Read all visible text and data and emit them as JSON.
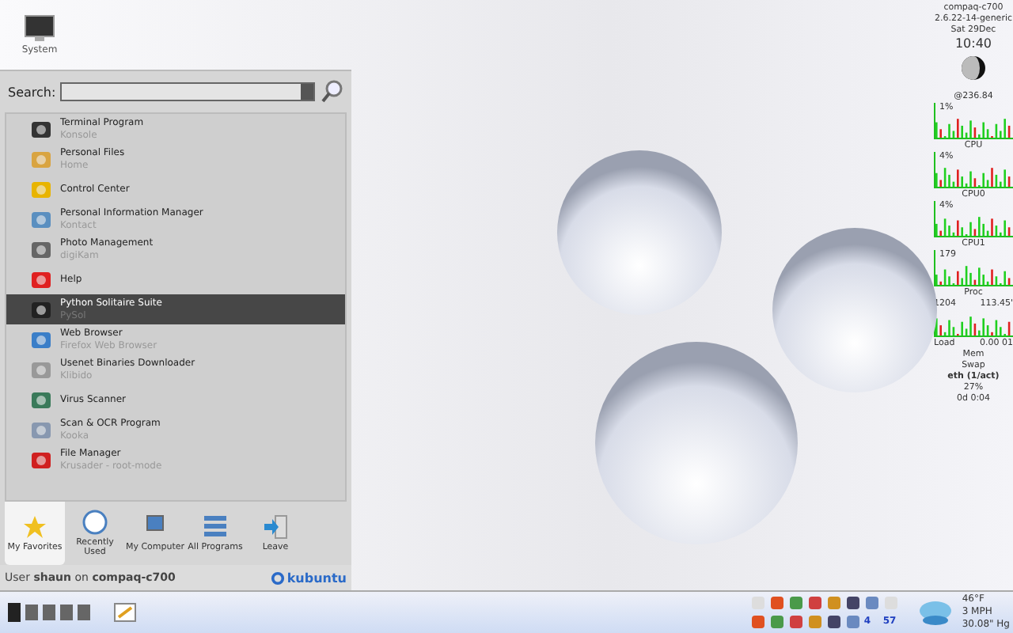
{
  "desktop_icon": {
    "label": "System"
  },
  "menu": {
    "search": {
      "label": "Search:"
    },
    "items": [
      {
        "title": "Terminal Program",
        "subtitle": "Konsole",
        "selected": false
      },
      {
        "title": "Personal Files",
        "subtitle": "Home",
        "selected": false
      },
      {
        "title": "Control Center",
        "selected": false
      },
      {
        "title": "Personal Information Manager",
        "subtitle": "Kontact",
        "selected": false
      },
      {
        "title": "Photo Management",
        "subtitle": "digiKam",
        "selected": false
      },
      {
        "title": "Help",
        "selected": false
      },
      {
        "title": "Python Solitaire Suite",
        "subtitle": "PySol",
        "selected": true
      },
      {
        "title": "Web Browser",
        "subtitle": "Firefox Web Browser",
        "selected": false
      },
      {
        "title": "Usenet Binaries Downloader",
        "subtitle": "Klibido",
        "selected": false
      },
      {
        "title": "Virus Scanner",
        "selected": false
      },
      {
        "title": "Scan & OCR Program",
        "subtitle": "Kooka",
        "selected": false
      },
      {
        "title": "File Manager",
        "subtitle": "Krusader - root-mode",
        "selected": false
      }
    ],
    "tabs": [
      {
        "label": "My Favorites",
        "selected": true
      },
      {
        "label": "Recently Used",
        "selected": false
      },
      {
        "label": "My Computer",
        "selected": false
      },
      {
        "label": "All Programs",
        "selected": false
      },
      {
        "label": "Leave",
        "selected": false
      }
    ],
    "footer": {
      "text": "User **shaun** on **compaq-c700**",
      "brand": "kubuntu"
    }
  },
  "monitor": [
    {
      "kind": "text",
      "text": "compaq-c700"
    },
    {
      "kind": "text",
      "text": "2.6.22-14-generic"
    },
    {
      "kind": "text",
      "text": "Sat 29Dec"
    },
    {
      "kind": "clock",
      "text": "10:40"
    },
    {
      "kind": "moon"
    },
    {
      "kind": "text",
      "text": "@236.84"
    },
    {
      "kind": "graph",
      "text": "1%"
    },
    {
      "kind": "text",
      "text": "CPU"
    },
    {
      "kind": "graph",
      "text": "4%"
    },
    {
      "kind": "text",
      "text": "CPU0"
    },
    {
      "kind": "graph",
      "text": "4%"
    },
    {
      "kind": "text",
      "text": "CPU1"
    },
    {
      "kind": "graph",
      "text": "179"
    },
    {
      "kind": "text",
      "text": "Proc"
    },
    {
      "kind": "pair",
      "text": "1204",
      "right": "113.45'"
    },
    {
      "kind": "graph"
    },
    {
      "kind": "pair",
      "text": "Load",
      "right": "0.00 01"
    },
    {
      "kind": "text",
      "text": "Mem"
    },
    {
      "kind": "text",
      "text": "Swap"
    },
    {
      "kind": "bold",
      "text": "eth (1/act)"
    },
    {
      "kind": "text",
      "text": "27%"
    },
    {
      "kind": "text",
      "text": "0d 0:04"
    }
  ],
  "taskbar": {
    "tray_badges": [
      "4",
      "57"
    ],
    "weather": [
      "46°F",
      "3 MPH",
      "30.08\" Hg"
    ]
  }
}
